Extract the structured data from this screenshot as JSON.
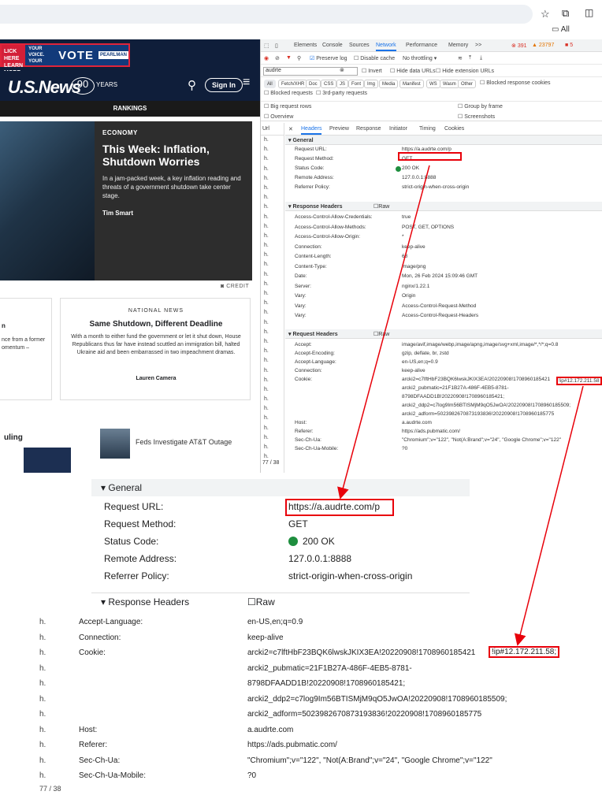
{
  "browser": {
    "bookmark_all": "All"
  },
  "site": {
    "ad": {
      "left": "LICK HERE LEARN MORE",
      "mid": "YOUR VOICE. YOUR",
      "vote": "VOTE",
      "end": "PEARLMAN"
    },
    "logo": "U.S.News",
    "years_num": "90",
    "years_label": "YEARS",
    "sign_in": "Sign In",
    "rankings": "RANKINGS",
    "hero": {
      "category": "ECONOMY",
      "title": "This Week: Inflation, Shutdown Worries",
      "desc": "In a jam-packed week, a key inflation reading and threats of a government shutdown take center stage.",
      "author": "Tim Smart",
      "credit": "CREDIT"
    },
    "card1": {
      "title": "n",
      "desc": "nce from a former omentum –"
    },
    "card2": {
      "category": "NATIONAL NEWS",
      "title": "Same Shutdown, Different Deadline",
      "desc": "With a month to either fund the government or let it shut down, House Republicans thus far have instead scuttled an immigration bill, halted Ukraine aid and been embarrassed in two impeachment dramas.",
      "author": "Lauren Camera"
    },
    "bottom": {
      "left_title": "uling",
      "headline": "Feds Investigate AT&T Outage"
    }
  },
  "devtools": {
    "tabs": [
      "Elements",
      "Console",
      "Sources",
      "Network",
      "Performance",
      "Memory"
    ],
    "more": ">>",
    "errors": "391",
    "warnings": "23797",
    "issues": "5",
    "preserve_log": "Preserve log",
    "disable_cache": "Disable cache",
    "throttling": "No throttling",
    "filter_value": "audrte",
    "invert": "Invert",
    "hide_data_urls": "Hide data URLs",
    "hide_ext_urls": "Hide extension URLs",
    "chips": [
      "All",
      "Fetch/XHR",
      "Doc",
      "CSS",
      "JS",
      "Font",
      "Img",
      "Media",
      "Manifest",
      "WS",
      "Wasm",
      "Other"
    ],
    "blocked_cookies": "Blocked response cookies",
    "blocked_requests": "Blocked requests",
    "third_party": "3rd-party requests",
    "big_rows": "Big request rows",
    "group_by_frame": "Group by frame",
    "overview": "Overview",
    "screenshots": "Screenshots",
    "url_col": "Url",
    "row_prefix": "h.",
    "total": "77 / 38",
    "pane_tabs": [
      "Headers",
      "Preview",
      "Response",
      "Initiator",
      "Timing",
      "Cookies"
    ],
    "general_label": "General",
    "general": [
      {
        "k": "Request URL:",
        "v": "https://a.audrte.com/p"
      },
      {
        "k": "Request Method:",
        "v": "GET"
      },
      {
        "k": "Status Code:",
        "v": "200 OK"
      },
      {
        "k": "Remote Address:",
        "v": "127.0.0.1:8888"
      },
      {
        "k": "Referrer Policy:",
        "v": "strict-origin-when-cross-origin"
      }
    ],
    "resp_label": "Response Headers",
    "raw": "Raw",
    "response": [
      {
        "k": "Access-Control-Allow-Credentials:",
        "v": "true"
      },
      {
        "k": "Access-Control-Allow-Methods:",
        "v": "POST, GET, OPTIONS"
      },
      {
        "k": "Access-Control-Allow-Origin:",
        "v": "*"
      },
      {
        "k": "Connection:",
        "v": "keep-alive"
      },
      {
        "k": "Content-Length:",
        "v": "68"
      },
      {
        "k": "Content-Type:",
        "v": "image/png"
      },
      {
        "k": "Date:",
        "v": "Mon, 26 Feb 2024 15:09:46 GMT"
      },
      {
        "k": "Server:",
        "v": "nginx/1.22.1"
      },
      {
        "k": "Vary:",
        "v": "Origin"
      },
      {
        "k": "Vary:",
        "v": "Access-Control-Request-Method"
      },
      {
        "k": "Vary:",
        "v": "Access-Control-Request-Headers"
      }
    ],
    "req_label": "Request Headers",
    "request": [
      {
        "k": "Accept:",
        "v": "image/avif,image/webp,image/apng,image/svg+xml,image/*,*/*;q=0.8"
      },
      {
        "k": "Accept-Encoding:",
        "v": "gzip, deflate, br, zstd"
      },
      {
        "k": "Accept-Language:",
        "v": "en-US,en;q=0.9"
      },
      {
        "k": "Connection:",
        "v": "keep-alive"
      },
      {
        "k": "Cookie:",
        "v": "arcki2=c7lftHbF23BQK6lwskJKIX3EA!20220908!1708960185421"
      },
      {
        "k": "",
        "v": "arcki2_pubmatic=21F1B27A-486F-4EB5-8781-"
      },
      {
        "k": "",
        "v": "8798DFAADD1B!20220908!1708960185421;"
      },
      {
        "k": "",
        "v": "arcki2_ddp2=c7log9Im56BTISMjM9qO5JwOA!20220908!1708960185509;"
      },
      {
        "k": "",
        "v": "arcki2_adform=5023982670873193836!20220908!1708960185775"
      },
      {
        "k": "Host:",
        "v": "a.audrte.com"
      },
      {
        "k": "Referer:",
        "v": "https://ads.pubmatic.com/"
      },
      {
        "k": "Sec-Ch-Ua:",
        "v": "\"Chromium\";v=\"122\", \"Not(A:Brand\";v=\"24\", \"Google Chrome\";v=\"122\""
      },
      {
        "k": "Sec-Ch-Ua-Mobile:",
        "v": "?0"
      }
    ],
    "cookie_ip": "!ip#12.172.211.58"
  },
  "zoom1": {
    "section_general": "General",
    "rows": [
      {
        "k": "Request URL:",
        "v": "https://a.audrte.com/p"
      },
      {
        "k": "Request Method:",
        "v": "GET"
      },
      {
        "k": "Status Code:",
        "v": "200 OK"
      },
      {
        "k": "Remote Address:",
        "v": "127.0.0.1:8888"
      },
      {
        "k": "Referrer Policy:",
        "v": "strict-origin-when-cross-origin"
      }
    ],
    "section_response": "Response Headers",
    "raw": "Raw"
  },
  "zoom2": {
    "rows": [
      {
        "i": "h.",
        "k": "Accept-Language:",
        "v": "en-US,en;q=0.9"
      },
      {
        "i": "h.",
        "k": "Connection:",
        "v": "keep-alive"
      },
      {
        "i": "h.",
        "k": "Cookie:",
        "v": "arcki2=c7lftHbF23BQK6lwskJKIX3EA!20220908!1708960185421"
      },
      {
        "i": "h.",
        "k": "",
        "v": "arcki2_pubmatic=21F1B27A-486F-4EB5-8781-"
      },
      {
        "i": "h.",
        "k": "",
        "v": "8798DFAADD1B!20220908!1708960185421;"
      },
      {
        "i": "h.",
        "k": "",
        "v": "arcki2_ddp2=c7log9Im56BTISMjM9qO5JwOA!20220908!1708960185509;"
      },
      {
        "i": "h.",
        "k": "",
        "v": "arcki2_adform=5023982670873193836!20220908!1708960185775"
      },
      {
        "i": "h.",
        "k": "Host:",
        "v": "a.audrte.com"
      },
      {
        "i": "h.",
        "k": "Referer:",
        "v": "https://ads.pubmatic.com/"
      },
      {
        "i": "h.",
        "k": "Sec-Ch-Ua:",
        "v": "\"Chromium\";v=\"122\", \"Not(A:Brand\";v=\"24\", \"Google Chrome\";v=\"122\""
      },
      {
        "i": "h.",
        "k": "Sec-Ch-Ua-Mobile:",
        "v": "?0"
      }
    ],
    "cookie_ip": "!ip#12.172.211.58;",
    "total": "77 / 38"
  },
  "colors": {
    "accent": "#1a73e8",
    "highlight": "#e8000a",
    "status_ok": "#1e8e3e",
    "site_navy": "#0f1e3a"
  }
}
